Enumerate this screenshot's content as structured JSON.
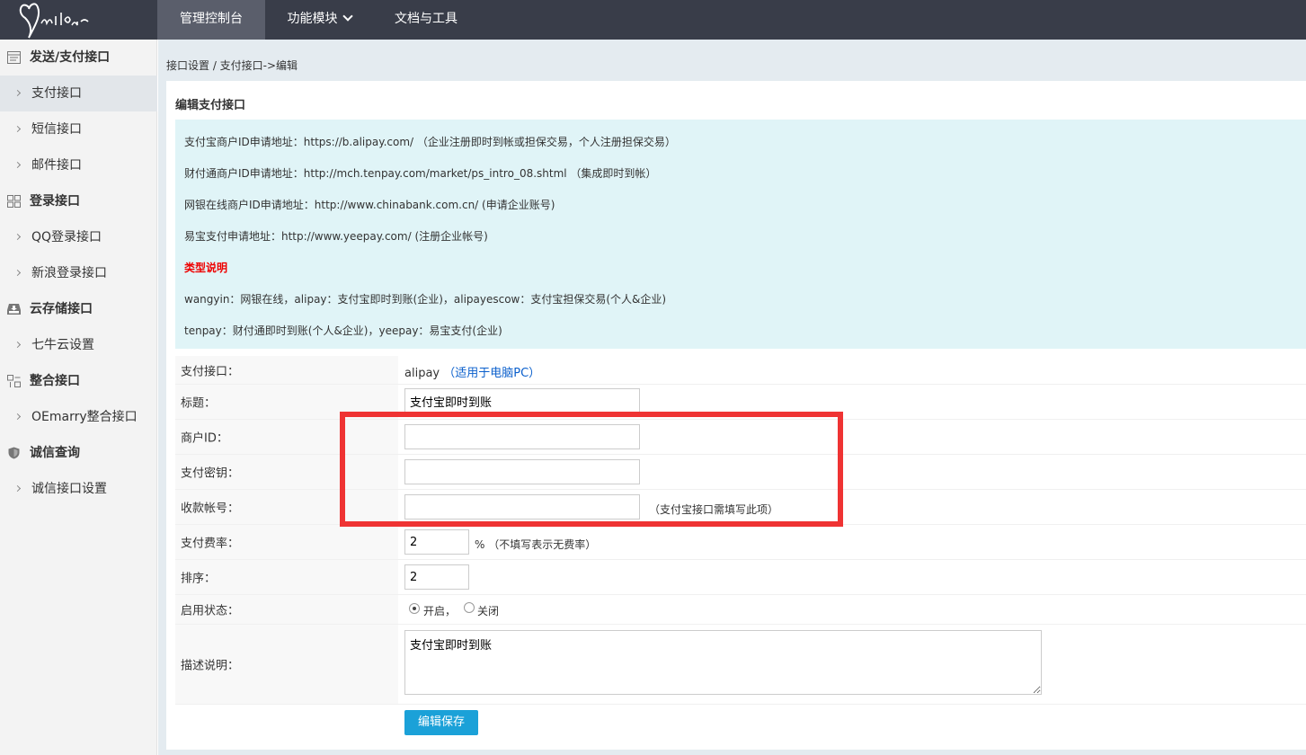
{
  "topbar": {
    "nav": [
      {
        "label": "管理控制台"
      },
      {
        "label": "功能模块"
      },
      {
        "label": "文档与工具"
      }
    ]
  },
  "sidebar": {
    "groups": [
      {
        "label": "发送/支付接口",
        "items": [
          "支付接口",
          "短信接口",
          "邮件接口"
        ]
      },
      {
        "label": "登录接口",
        "items": [
          "QQ登录接口",
          "新浪登录接口"
        ]
      },
      {
        "label": "云存储接口",
        "items": [
          "七牛云设置"
        ]
      },
      {
        "label": "整合接口",
        "items": [
          "OEmarry整合接口"
        ]
      },
      {
        "label": "诚信查询",
        "items": [
          "诚信接口设置"
        ]
      }
    ]
  },
  "breadcrumb": "接口设置 / 支付接口->编辑",
  "panel": {
    "title": "编辑支付接口",
    "info": [
      "支付宝商户ID申请地址：https://b.alipay.com/ （企业注册即时到帐或担保交易，个人注册担保交易）",
      "财付通商户ID申请地址：http://mch.tenpay.com/market/ps_intro_08.shtml （集成即时到帐）",
      "网银在线商户ID申请地址：http://www.chinabank.com.cn/ (申请企业账号)",
      "易宝支付申请地址：http://www.yeepay.com/ (注册企业帐号)",
      "类型说明",
      "wangyin：网银在线，alipay：支付宝即时到账(企业)，alipayescow：支付宝担保交易(个人&企业)",
      "tenpay：财付通即时到账(个人&企业)，yeepay：易宝支付(企业)"
    ]
  },
  "form": {
    "interface_label": "支付接口：",
    "interface_value": "alipay",
    "interface_note": "（适用于电脑PC）",
    "title_label": "标题：",
    "title_value": "支付宝即时到账",
    "merchant_label": "商户ID：",
    "merchant_value": "",
    "secret_label": "支付密钥：",
    "secret_value": "",
    "account_label": "收款帐号：",
    "account_value": "",
    "account_hint": "（支付宝接口需填写此项）",
    "fee_label": "支付费率：",
    "fee_value": "2",
    "fee_hint": "% （不填写表示无费率）",
    "sort_label": "排序：",
    "sort_value": "2",
    "status_label": "启用状态：",
    "status_on": "开启，",
    "status_off": "关闭",
    "desc_label": "描述说明：",
    "desc_value": "支付宝即时到账",
    "save_label": "编辑保存"
  },
  "colors": {
    "topbar": "#393d49",
    "infobox": "#e0f4f7",
    "button": "#1ba1d8",
    "highlight": "#ef3333",
    "note_red": "#ee0000"
  }
}
